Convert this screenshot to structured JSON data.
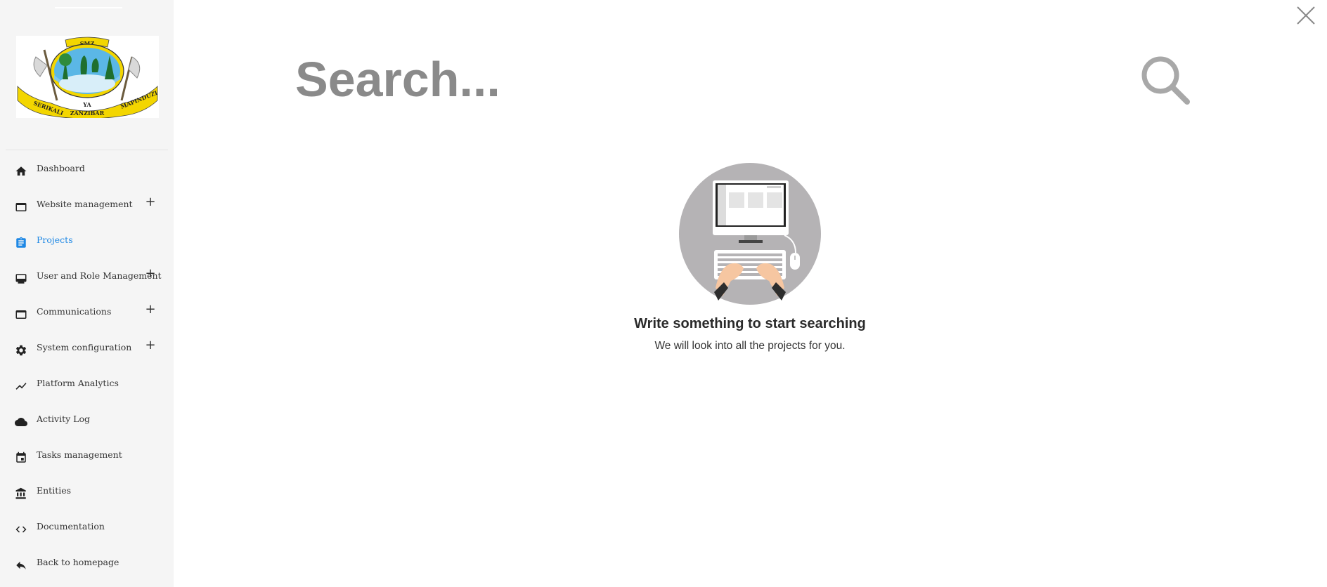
{
  "sidebar": {
    "logo_alt": "SMZ Serikali ya Mapinduzi Zanzibar",
    "logo_text": {
      "top": "SMZ",
      "left": "SERIKALI",
      "center": "YA",
      "right": "MAPINDUZI",
      "bottom": "ZANZIBAR"
    },
    "items": [
      {
        "label": "Dashboard",
        "icon": "home-icon",
        "expandable": false,
        "active": false
      },
      {
        "label": "Website management",
        "icon": "window-icon",
        "expandable": true,
        "active": false
      },
      {
        "label": "Projects",
        "icon": "clipboard-icon",
        "expandable": false,
        "active": true
      },
      {
        "label": "User and Role Management",
        "icon": "monitor-icon",
        "expandable": true,
        "active": false
      },
      {
        "label": "Communications",
        "icon": "window-icon",
        "expandable": true,
        "active": false
      },
      {
        "label": "System configuration",
        "icon": "gear-icon",
        "expandable": true,
        "active": false
      },
      {
        "label": "Platform Analytics",
        "icon": "trending-icon",
        "expandable": false,
        "active": false
      },
      {
        "label": "Activity Log",
        "icon": "cloud-icon",
        "expandable": false,
        "active": false
      },
      {
        "label": "Tasks management",
        "icon": "calendar-icon",
        "expandable": false,
        "active": false
      },
      {
        "label": "Entities",
        "icon": "bank-icon",
        "expandable": false,
        "active": false
      },
      {
        "label": "Documentation",
        "icon": "code-icon",
        "expandable": false,
        "active": false
      },
      {
        "label": "Back to homepage",
        "icon": "reply-icon",
        "expandable": false,
        "active": false
      }
    ],
    "expand_symbol": "+"
  },
  "search": {
    "placeholder": "Search...",
    "value": ""
  },
  "empty_state": {
    "title": "Write something to start searching",
    "subtitle": "We will look into all the projects for you."
  },
  "colors": {
    "accent": "#1e88e5",
    "sidebar_bg": "#f5f5f5",
    "text": "#333333"
  }
}
